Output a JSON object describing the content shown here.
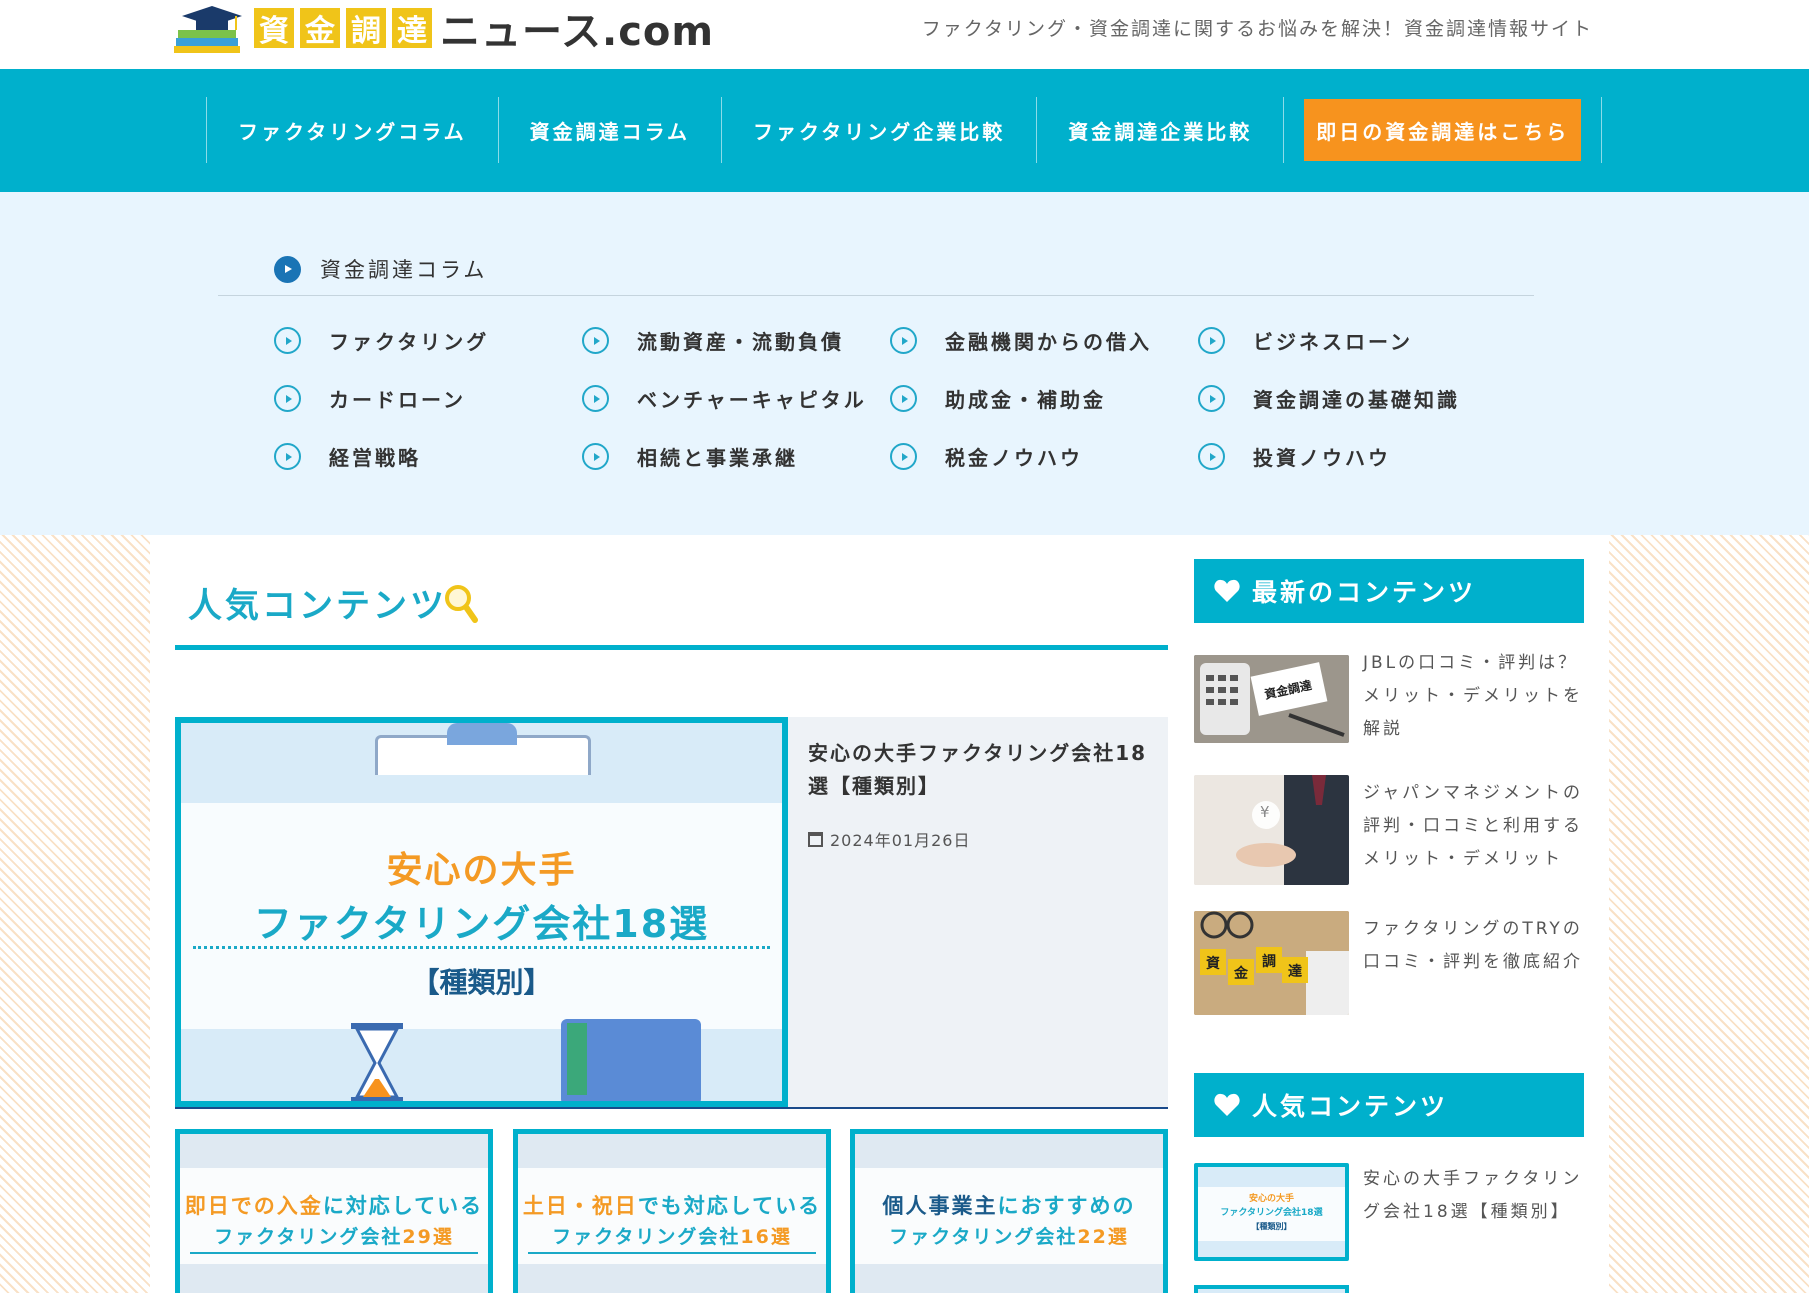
{
  "header": {
    "logo_boxes": [
      "資",
      "金",
      "調",
      "達"
    ],
    "logo_rest": "ニュース.com",
    "tagline": "ファクタリング・資金調達に関するお悩みを解決！資金調達情報サイト"
  },
  "nav": {
    "items": [
      "ファクタリングコラム",
      "資金調達コラム",
      "ファクタリング企業比較",
      "資金調達企業比較"
    ],
    "cta": "即日の資金調達はこちら"
  },
  "submenu": {
    "heading": "資金調達コラム",
    "items": [
      "ファクタリング",
      "流動資産・流動負債",
      "金融機関からの借入",
      "ビジネスローン",
      "カードローン",
      "ベンチャーキャピタル",
      "助成金・補助金",
      "資金調達の基礎知識",
      "経営戦略",
      "相続と事業承継",
      "税金ノウハウ",
      "投資ノウハウ"
    ]
  },
  "popular": {
    "title": "人気コンテンツ",
    "feature": {
      "image_line1": "安心の大手",
      "image_line2": "ファクタリング会社18選",
      "image_line3": "【種類別】",
      "title": "安心の大手ファクタリング会社18選【種類別】",
      "date": "2024年01月26日"
    },
    "thumbs": [
      {
        "l1a": "即日での入金",
        "l1b": "に対応している",
        "l2a": "ファクタリング会社",
        "l2b": "29選"
      },
      {
        "l1a": "土日・祝日",
        "l1b": "でも対応している",
        "l2a": "ファクタリング会社",
        "l2b": "16選"
      },
      {
        "l1a": "個人事業主",
        "l1b": "におすすめの",
        "l2a": "ファクタリング会社",
        "l2b": "22選"
      }
    ]
  },
  "sidebar": {
    "latest_heading": "最新のコンテンツ",
    "latest": [
      {
        "title": "JBLの口コミ・評判は？メリット・デメリットを解説",
        "image_label": "資金調達"
      },
      {
        "title": "ジャパンマネジメントの評判・口コミと利用するメリット・デメリット",
        "image_label": "¥"
      },
      {
        "title": "ファクタリングのTRYの口コミ・評判を徹底紹介",
        "image_blocks": [
          "資",
          "金",
          "調",
          "達"
        ]
      }
    ],
    "popular_heading": "人気コンテンツ",
    "popular": [
      {
        "title": "安心の大手ファクタリング会社18選【種類別】",
        "image_line1": "安心の大手",
        "image_line2": "ファクタリング会社18選",
        "image_line3": "【種類別】"
      }
    ]
  },
  "colors": {
    "primary": "#00b0cc",
    "accent": "#f7931e",
    "submenu_bg": "#e8f5fe",
    "logo_yellow": "#f0c419"
  }
}
